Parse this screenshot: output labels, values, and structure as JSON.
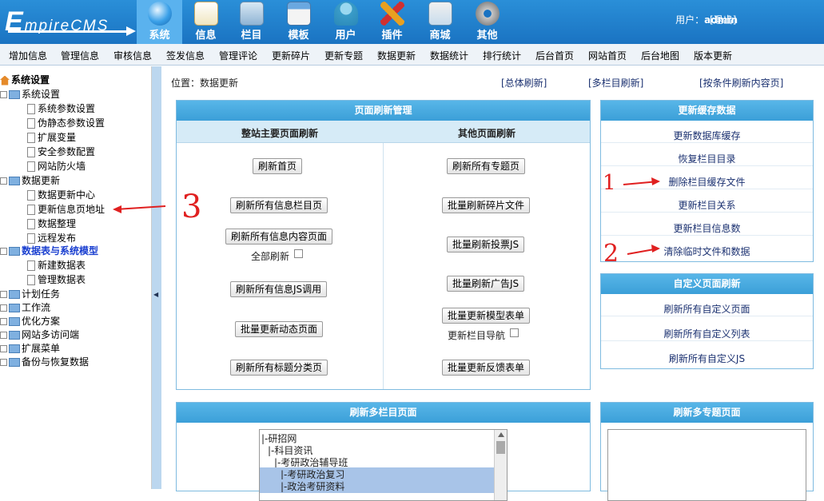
{
  "header": {
    "logo": {
      "first_letter": "E",
      "rest": "mpireCMS"
    },
    "tabs": [
      {
        "label": "系统",
        "icon": "globe-icon",
        "active": true
      },
      {
        "label": "信息",
        "icon": "notepad-icon"
      },
      {
        "label": "栏目",
        "icon": "folder-icon"
      },
      {
        "label": "模板",
        "icon": "window-icon"
      },
      {
        "label": "用户",
        "icon": "user-icon"
      },
      {
        "label": "插件",
        "icon": "tools-icon"
      },
      {
        "label": "商城",
        "icon": "card-icon"
      },
      {
        "label": "其他",
        "icon": "gear-icon"
      }
    ],
    "user_label": "用户：",
    "username": "admin",
    "logout": "[退出]"
  },
  "subnav": [
    "增加信息",
    "管理信息",
    "审核信息",
    "签发信息",
    "管理评论",
    "更新碎片",
    "更新专题",
    "数据更新",
    "数据统计",
    "排行统计",
    "后台首页",
    "网站首页",
    "后台地图",
    "版本更新"
  ],
  "sidebar": {
    "tree": [
      {
        "label": "系统设置",
        "type": "root"
      },
      {
        "label": "系统设置",
        "type": "folder"
      },
      {
        "label": "系统参数设置",
        "type": "doc"
      },
      {
        "label": "伪静态参数设置",
        "type": "doc"
      },
      {
        "label": "扩展变量",
        "type": "doc"
      },
      {
        "label": "安全参数配置",
        "type": "doc"
      },
      {
        "label": "网站防火墙",
        "type": "doc"
      },
      {
        "label": "数据更新",
        "type": "folder"
      },
      {
        "label": "数据更新中心",
        "type": "doc"
      },
      {
        "label": "更新信息页地址",
        "type": "doc"
      },
      {
        "label": "数据整理",
        "type": "doc"
      },
      {
        "label": "远程发布",
        "type": "doc"
      },
      {
        "label": "数据表与系统模型",
        "type": "folder-active"
      },
      {
        "label": "新建数据表",
        "type": "doc"
      },
      {
        "label": "管理数据表",
        "type": "doc"
      },
      {
        "label": "计划任务",
        "type": "folder-closed"
      },
      {
        "label": "工作流",
        "type": "folder-closed"
      },
      {
        "label": "优化方案",
        "type": "folder-closed"
      },
      {
        "label": "网站多访问端",
        "type": "folder-closed"
      },
      {
        "label": "扩展菜单",
        "type": "folder-closed"
      },
      {
        "label": "备份与恢复数据",
        "type": "folder-closed"
      }
    ]
  },
  "main": {
    "location_label": "位置：",
    "location_value": "数据更新",
    "top_links": [
      "[总体刷新]",
      "[多栏目刷新]",
      "[按条件刷新内容页]"
    ],
    "refresh_panel": {
      "title": "页面刷新管理",
      "col_left_title": "整站主要页面刷新",
      "col_right_title": "其他页面刷新",
      "left_buttons": [
        "刷新首页",
        "刷新所有信息栏目页",
        "刷新所有信息内容页面",
        "刷新所有信息JS调用",
        "批量更新动态页面",
        "刷新所有标题分类页"
      ],
      "full_refresh_label": "全部刷新",
      "right_buttons": [
        "刷新所有专题页",
        "批量刷新碎片文件",
        "批量刷新投票JS",
        "批量刷新广告JS",
        "批量更新模型表单",
        "批量更新反馈表单"
      ],
      "nav_label": "更新栏目导航"
    },
    "cache_panel": {
      "title": "更新缓存数据",
      "links": [
        "更新数据库缓存",
        "恢复栏目目录",
        "删除栏目缓存文件",
        "更新栏目关系",
        "更新栏目信息数",
        "清除临时文件和数据"
      ]
    },
    "custom_panel": {
      "title": "自定义页面刷新",
      "links": [
        "刷新所有自定义页面",
        "刷新所有自定义列表",
        "刷新所有自定义JS"
      ]
    },
    "multi_column_panel": {
      "title": "刷新多栏目页面",
      "list": [
        "|-研招网",
        "|-科目资讯",
        "|-考研政治辅导班",
        "|-考研政治复习",
        "|-政治考研资料"
      ]
    },
    "multi_topic_panel": {
      "title": "刷新多专题页面"
    }
  },
  "annotations": [
    "1",
    "2",
    "3"
  ],
  "colors": {
    "header_blue": "#1a73c2",
    "panel_head": "#3b9fd8",
    "annotation_red": "#e02020"
  }
}
